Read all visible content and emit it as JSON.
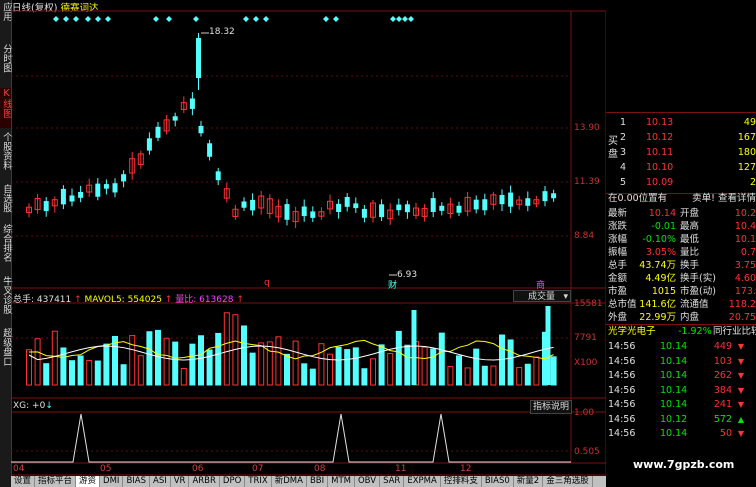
{
  "header": {
    "title": "日线(复权)",
    "name": "德赛词达"
  },
  "left_tabs": [
    {
      "label": "应用",
      "active": false
    },
    {
      "label": "分时图",
      "active": false
    },
    {
      "label": "K线图",
      "active": true
    },
    {
      "label": "个股资料",
      "active": false
    },
    {
      "label": "自选股",
      "active": false
    },
    {
      "label": "综合排名",
      "active": false
    },
    {
      "label": "牛叉诊股",
      "active": false
    },
    {
      "label": "超级盘口",
      "active": false
    }
  ],
  "price_axis": [
    "13.90",
    "11.39",
    "8.84"
  ],
  "annotations": {
    "high": "18.32",
    "low": "6.93",
    "q": "q",
    "cai": "财",
    "shang": "商"
  },
  "volume_header": {
    "zongshou": "总手: 437411",
    "mavol": "MAVOL5: 554025",
    "liangbi": "量比: 613628",
    "selector": "成交量"
  },
  "volume_axis": [
    "15581",
    "7791",
    "X100"
  ],
  "indicator_header": {
    "name": "XG: +0",
    "button": "指标说明"
  },
  "indicator_axis": [
    "1.00",
    "0.505"
  ],
  "date_axis": [
    "04",
    "05",
    "06",
    "07",
    "08",
    "11",
    "12"
  ],
  "bottom_tabs": [
    {
      "label": "设置",
      "active": false
    },
    {
      "label": "指标平台",
      "active": false
    },
    {
      "label": "游资",
      "active": true
    },
    {
      "label": "DMI",
      "active": false
    },
    {
      "label": "BIAS",
      "active": false
    },
    {
      "label": "ASI",
      "active": false
    },
    {
      "label": "VR",
      "active": false
    },
    {
      "label": "ARBR",
      "active": false
    },
    {
      "label": "DPO",
      "active": false
    },
    {
      "label": "TRIX",
      "active": false
    },
    {
      "label": "新DMA",
      "active": false
    },
    {
      "label": "BBI",
      "active": false
    },
    {
      "label": "MTM",
      "active": false
    },
    {
      "label": "OBV",
      "active": false
    },
    {
      "label": "SAR",
      "active": false
    },
    {
      "label": "EXPMA",
      "active": false
    },
    {
      "label": "控排料支",
      "active": false
    },
    {
      "label": "BIAS0",
      "active": false
    },
    {
      "label": "新量2",
      "active": false
    },
    {
      "label": "金三角选股",
      "active": false
    }
  ],
  "order_book": {
    "buy_label": "买盘",
    "rows": [
      {
        "level": "1",
        "price": "10.13",
        "vol": "49"
      },
      {
        "level": "2",
        "price": "10.12",
        "vol": "167"
      },
      {
        "level": "3",
        "price": "10.11",
        "vol": "180"
      },
      {
        "level": "4",
        "price": "10.10",
        "vol": "127"
      },
      {
        "level": "5",
        "price": "10.09",
        "vol": "2"
      }
    ]
  },
  "status_line": {
    "left": "在0.00位置有",
    "right": "卖单! 查看详情"
  },
  "quote": [
    {
      "k1": "最新",
      "v1": "10.14",
      "k2": "开盘",
      "v2": "10.2"
    },
    {
      "k1": "涨跌",
      "v1": "-0.01",
      "k2": "最高",
      "v2": "10.4"
    },
    {
      "k1": "涨幅",
      "v1": "-0.10%",
      "k2": "最低",
      "v2": "10.1"
    },
    {
      "k1": "振幅",
      "v1": "3.05%",
      "k2": "量比",
      "v2": "0.7"
    },
    {
      "k1": "总手",
      "v1": "43.74万",
      "k2": "换手",
      "v2": "3.75"
    },
    {
      "k1": "金额",
      "v1": "4.49亿",
      "k2": "换手(实)",
      "v2": "4.60"
    },
    {
      "k1": "市盈",
      "v1": "1015",
      "k2": "市盈(动)",
      "v2": "173."
    },
    {
      "k1": "总市值",
      "v1": "141.6亿",
      "k2": "流通值",
      "v2": "118.2"
    },
    {
      "k1": "外盘",
      "v1": "22.99万",
      "k2": "内盘",
      "v2": "20.75"
    }
  ],
  "sector": {
    "name": "光学光电子",
    "change": "-1.92%",
    "link": "同行业比较"
  },
  "ticks": [
    {
      "time": "14:56",
      "price": "10.14",
      "vol": "449",
      "dir": "down"
    },
    {
      "time": "14:56",
      "price": "10.14",
      "vol": "103",
      "dir": "down"
    },
    {
      "time": "14:56",
      "price": "10.14",
      "vol": "262",
      "dir": "down"
    },
    {
      "time": "14:56",
      "price": "10.14",
      "vol": "384",
      "dir": "down"
    },
    {
      "time": "14:56",
      "price": "10.14",
      "vol": "241",
      "dir": "down"
    },
    {
      "time": "14:56",
      "price": "10.12",
      "vol": "572",
      "dir": "up"
    },
    {
      "time": "14:56",
      "price": "10.14",
      "vol": "50",
      "dir": "down"
    }
  ],
  "watermark": "www.7gpzb.com"
}
